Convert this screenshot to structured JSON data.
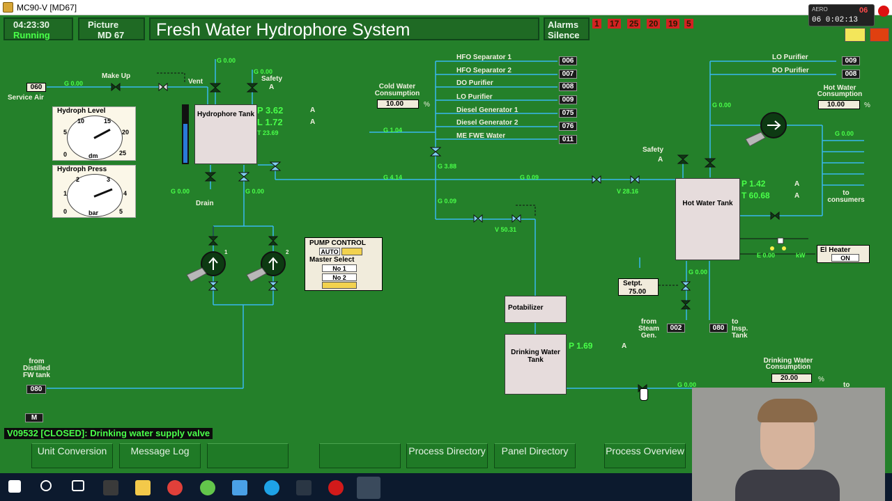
{
  "window": {
    "title": "MC90-V [MD67]"
  },
  "header": {
    "time": "04:23:30",
    "run_state": "Running",
    "picture_label": "Picture",
    "picture_id": "MD  67",
    "system_title": "Fresh Water Hydrophore System",
    "alarms_label": "Alarms",
    "silence_label": "Silence",
    "alarm_counts": [
      "1",
      "17",
      "25",
      "20",
      "19",
      "5"
    ]
  },
  "mini_clock": {
    "top": "06",
    "bottom": "06 0:02:13",
    "label": "AERO"
  },
  "left": {
    "service_air_tag": "060",
    "service_air_label": "Service Air",
    "service_air_flow": "G 0.00",
    "make_up_label": "Make Up",
    "vent_label": "Vent",
    "vent_flow": "G 0.00",
    "safety_label": "Safety",
    "safety_flow": "G 0.00",
    "safety_mode": "A",
    "hydroph_level": {
      "title": "Hydroph Level",
      "unit": "dm",
      "ticks": [
        "0",
        "5",
        "10",
        "15",
        "20",
        "25"
      ]
    },
    "hydroph_press": {
      "title": "Hydroph Press",
      "unit": "bar",
      "ticks": [
        "0",
        "1",
        "2",
        "3",
        "4",
        "5"
      ]
    },
    "hydrophore_tank": "Hydrophore Tank",
    "tank_p": "P 3.62",
    "tank_l": "L 1.72",
    "tank_t": "T 23.69",
    "tank_mode_a1": "A",
    "tank_mode_a2": "A",
    "drain_label": "Drain",
    "drain_flow": "G 0.00",
    "outlet_flow": "G 0.00",
    "pump1": "1",
    "pump2": "2",
    "from_distilled_label": "from Distilled FW tank",
    "from_distilled_tag": "080",
    "m_tag": "M"
  },
  "pump_control": {
    "title": "PUMP CONTROL",
    "auto_label": "AUTO",
    "master_select": "Master Select",
    "no1": "No 1",
    "no2": "No 2"
  },
  "middle": {
    "cold_water_label": "Cold Water Consumption",
    "cold_water_value": "10.00",
    "cold_water_unit": "%",
    "flow_left": "G 1.04",
    "flow_main": "G 4.14",
    "flow_branch": "G 3.88",
    "flow_down": "G 0.09",
    "valve_v1": "V 50.31",
    "flow_hot": "G 0.09",
    "valve_v2": "V 28.16",
    "consumers": [
      {
        "name": "HFO Separator 1",
        "tag": "006"
      },
      {
        "name": "HFO Separator 2",
        "tag": "007"
      },
      {
        "name": "DO Purifier",
        "tag": "008"
      },
      {
        "name": "LO Purifier",
        "tag": "009"
      },
      {
        "name": "Diesel Generator 1",
        "tag": "075"
      },
      {
        "name": "Diesel Generator 2",
        "tag": "076"
      },
      {
        "name": "ME FWE Water",
        "tag": "011"
      }
    ],
    "potabilizer": "Potabilizer",
    "drinking_tank": "Drinking Water Tank",
    "drinking_p": "P 1.69",
    "drinking_mode": "A"
  },
  "right": {
    "lo_purifier": "LO Purifier",
    "lo_tag": "009",
    "do_purifier": "DO Purifier",
    "do_tag": "008",
    "hot_water_label": "Hot Water Consumption",
    "hot_water_value": "10.00",
    "hot_water_unit": "%",
    "flow_top": "G 0.00",
    "flow_out": "G 0.00",
    "safety_label": "Safety",
    "safety_mode": "A",
    "hot_tank": "Hot Water Tank",
    "hot_p": "P 1.42",
    "hot_t": "T 60.68",
    "hot_mode1": "A",
    "hot_mode2": "A",
    "to_consumers": "to consumers",
    "el_heater_label": "El Heater",
    "el_heater_state": "ON",
    "heater_power": "E 0.00",
    "heater_unit": "kW",
    "setpt_label": "Setpt.",
    "setpt_value": "75.00",
    "steam_flow": "G 0.00",
    "from_steam_label": "from Steam Gen.",
    "from_steam_tag": "002",
    "to_insp_label": "to Insp. Tank",
    "to_insp_tag": "080",
    "drinking_consumption_label": "Drinking Water Consumption",
    "drinking_consumption_value": "20.00",
    "drinking_consumption_unit": "%",
    "drinking_flow": "G 0.00",
    "to_label": "to"
  },
  "status_message": "V09532 [CLOSED]: Drinking water supply valve",
  "footer": {
    "btn1": "Unit Conversion",
    "btn2": "Message Log",
    "btn3": "",
    "btn4": "",
    "btn5": "Process Directory",
    "btn6": "Panel Directory",
    "btn7": "Process Overview"
  },
  "colors": {
    "background": "#24802a",
    "pipe_blue": "#38b8f0",
    "value_green": "#49ff49",
    "alarm_red": "#d42222"
  }
}
